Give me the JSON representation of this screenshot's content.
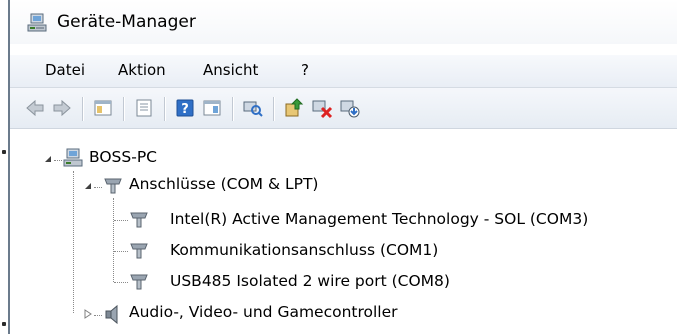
{
  "window": {
    "title": "Geräte-Manager"
  },
  "menu": {
    "items": [
      "Datei",
      "Aktion",
      "Ansicht",
      "?"
    ]
  },
  "toolbar": {
    "buttons": [
      "back-icon",
      "forward-icon",
      "show-hide-console-tree-icon",
      "properties-icon",
      "help-icon",
      "action-pane-icon",
      "scan-for-hardware-icon",
      "update-driver-icon",
      "uninstall-icon",
      "disable-device-icon"
    ]
  },
  "tree": {
    "root": "BOSS-PC",
    "category": "Anschlüsse (COM & LPT)",
    "devices": [
      "Intel(R) Active Management Technology - SOL (COM3)",
      "Kommunikationsanschluss (COM1)",
      "USB485 Isolated 2 wire port (COM8)"
    ],
    "next_category": "Audio-, Video- und Gamecontroller"
  }
}
